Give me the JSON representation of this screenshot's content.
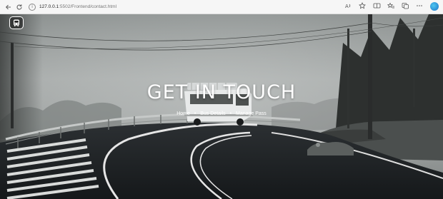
{
  "browser": {
    "url_host": "127.0.0.1",
    "url_path": ":5502/Frontend/contact.html",
    "back_icon": "back-arrow-icon",
    "reload_icon": "reload-icon"
  },
  "hero": {
    "title": "GET IN TOUCH",
    "breadcrumb": [
      {
        "label": "Home"
      },
      {
        "label": "Bus Details"
      },
      {
        "label": "Manage Pass"
      }
    ],
    "separator": "•",
    "logo_icon": "bus-icon"
  },
  "colors": {
    "sky": "#a8acac",
    "road": "#1c1f22",
    "road_line": "#eaeaea",
    "text": "#ffffff"
  }
}
